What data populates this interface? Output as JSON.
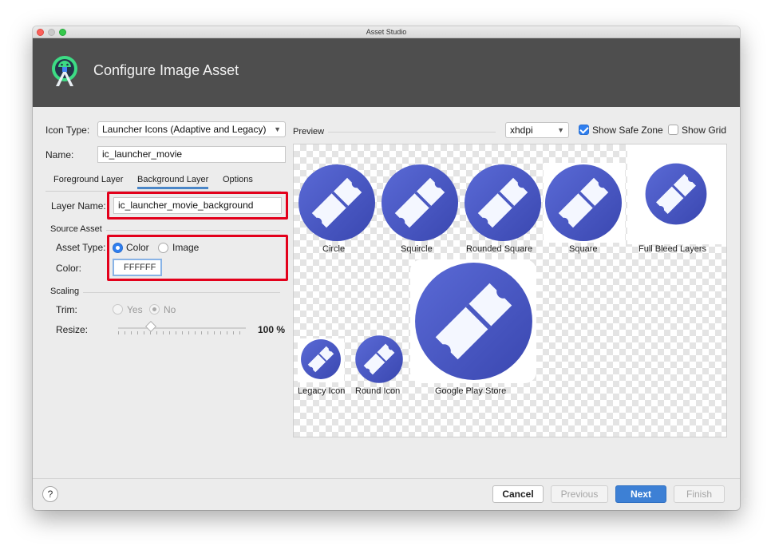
{
  "window": {
    "title": "Asset Studio"
  },
  "header": {
    "title": "Configure Image Asset",
    "logo_icon": "android-studio-logo-icon"
  },
  "form": {
    "icon_type_label": "Icon Type:",
    "icon_type_value": "Launcher Icons (Adaptive and Legacy)",
    "name_label": "Name:",
    "name_value": "ic_launcher_movie",
    "tabs": [
      "Foreground Layer",
      "Background Layer",
      "Options"
    ],
    "active_tab": "Background Layer",
    "layer_name_label": "Layer Name:",
    "layer_name_value": "ic_launcher_movie_background",
    "source_asset_label": "Source Asset",
    "asset_type_label": "Asset Type:",
    "asset_type_options": [
      "Color",
      "Image"
    ],
    "asset_type_selected": "Color",
    "color_label": "Color:",
    "color_value": "FFFFFF",
    "scaling_label": "Scaling",
    "trim_label": "Trim:",
    "trim_options": [
      "Yes",
      "No"
    ],
    "trim_selected": "No",
    "resize_label": "Resize:",
    "resize_value": "100 %"
  },
  "preview": {
    "label": "Preview",
    "density_value": "xhdpi",
    "show_safe_zone_label": "Show Safe Zone",
    "show_safe_zone_checked": true,
    "show_grid_label": "Show Grid",
    "show_grid_checked": false,
    "icons": {
      "circle": "Circle",
      "squircle": "Squircle",
      "rounded_square": "Rounded Square",
      "square": "Square",
      "full_bleed": "Full Bleed Layers",
      "legacy": "Legacy Icon",
      "round": "Round Icon",
      "play_store": "Google Play Store"
    }
  },
  "footer": {
    "help_label": "?",
    "cancel_label": "Cancel",
    "previous_label": "Previous",
    "next_label": "Next",
    "finish_label": "Finish"
  },
  "colors": {
    "icon_blue": "#4756c0",
    "accent": "#3d80d5",
    "highlight_red": "#e3001b",
    "header_bg": "#4e4e4e"
  }
}
